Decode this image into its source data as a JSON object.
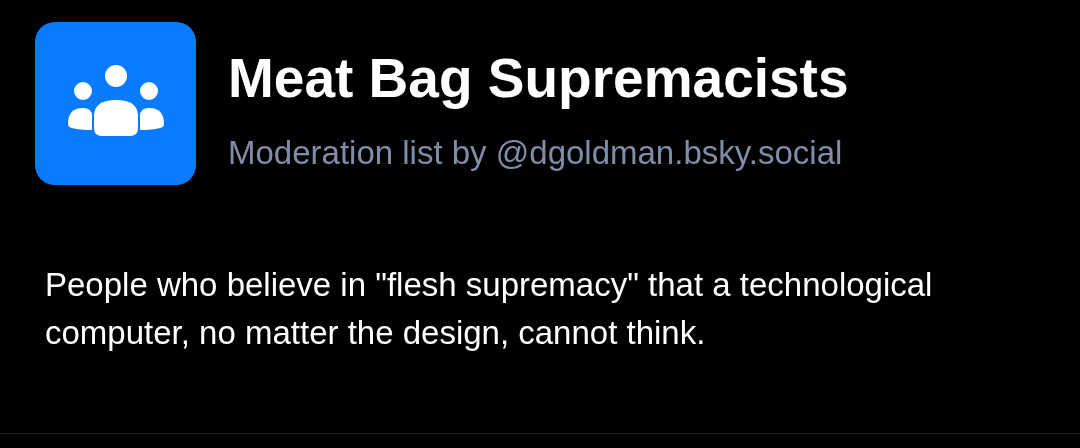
{
  "list": {
    "title": "Meat Bag Supremacists",
    "subtitle": "Moderation list by @dgoldman.bsky.social",
    "description": "People who believe in \"flesh supremacy\" that a technological computer, no matter the design, cannot think."
  }
}
